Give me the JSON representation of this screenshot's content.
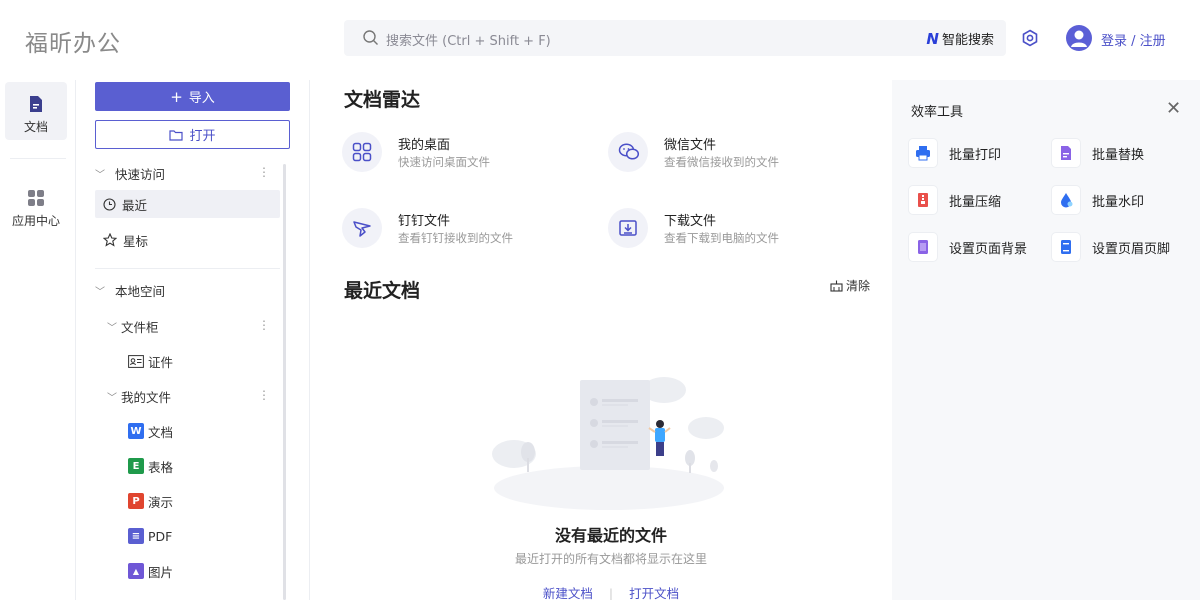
{
  "app": {
    "brand": "福昕办公"
  },
  "header": {
    "search_placeholder": "搜索文件 (Ctrl + Shift + F)",
    "ai_search_label": "智能搜索",
    "ai_logo": "N",
    "login_label": "登录 / 注册"
  },
  "rail": {
    "items": [
      {
        "label": "文档",
        "icon": "document-icon"
      },
      {
        "label": "应用中心",
        "icon": "apps-grid-icon"
      }
    ]
  },
  "nav": {
    "import_label": "导入",
    "open_label": "打开",
    "quick_access": "快速访问",
    "recent": "最近",
    "starred": "星标",
    "local_space": "本地空间",
    "file_cabinet": "文件柜",
    "certificates": "证件",
    "my_files": "我的文件",
    "types": [
      {
        "label": "文档",
        "badge": "W",
        "color": "#2f6ef0"
      },
      {
        "label": "表格",
        "badge": "E",
        "color": "#1f9a4b"
      },
      {
        "label": "演示",
        "badge": "P",
        "color": "#e0452f"
      },
      {
        "label": "PDF",
        "badge": "≡",
        "color": "#5a5fd1"
      },
      {
        "label": "图片",
        "badge": "▲",
        "color": "#6f57d6"
      }
    ]
  },
  "main": {
    "radar_title": "文档雷达",
    "radar": [
      {
        "title": "我的桌面",
        "desc": "快速访问桌面文件",
        "icon": "desktop-grid-icon"
      },
      {
        "title": "微信文件",
        "desc": "查看微信接收到的文件",
        "icon": "wechat-icon"
      },
      {
        "title": "钉钉文件",
        "desc": "查看钉钉接收到的文件",
        "icon": "dingtalk-icon"
      },
      {
        "title": "下载文件",
        "desc": "查看下载到电脑的文件",
        "icon": "download-icon"
      }
    ],
    "recent_title": "最近文档",
    "clear_label": "清除",
    "empty_title": "没有最近的文件",
    "empty_sub": "最近打开的所有文档都将显示在这里",
    "new_doc": "新建文档",
    "open_doc": "打开文档"
  },
  "tools": {
    "title": "效率工具",
    "items": [
      {
        "label": "批量打印",
        "icon": "print-icon",
        "color": "#2f6ef0"
      },
      {
        "label": "批量替换",
        "icon": "replace-icon",
        "color": "#8a63e6"
      },
      {
        "label": "批量压缩",
        "icon": "compress-icon",
        "color": "#e9504b"
      },
      {
        "label": "批量水印",
        "icon": "watermark-icon",
        "color": "#2f6ef0"
      },
      {
        "label": "设置页面背景",
        "icon": "page-background-icon",
        "color": "#8a63e6"
      },
      {
        "label": "设置页眉页脚",
        "icon": "header-footer-icon",
        "color": "#2f6ef0"
      }
    ]
  }
}
